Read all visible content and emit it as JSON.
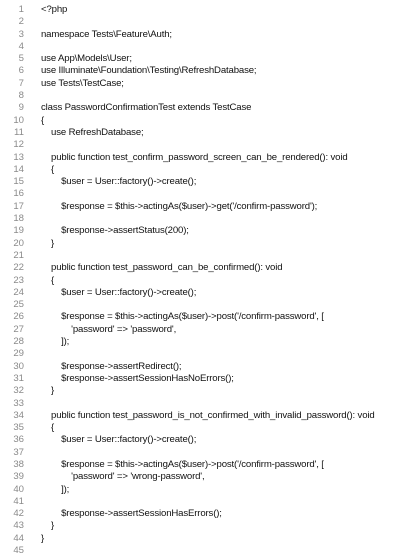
{
  "editor": {
    "lines": [
      {
        "n": "1",
        "t": "<?php"
      },
      {
        "n": "2",
        "t": ""
      },
      {
        "n": "3",
        "t": "namespace Tests\\Feature\\Auth;"
      },
      {
        "n": "4",
        "t": ""
      },
      {
        "n": "5",
        "t": "use App\\Models\\User;"
      },
      {
        "n": "6",
        "t": "use Illuminate\\Foundation\\Testing\\RefreshDatabase;"
      },
      {
        "n": "7",
        "t": "use Tests\\TestCase;"
      },
      {
        "n": "8",
        "t": ""
      },
      {
        "n": "9",
        "t": "class PasswordConfirmationTest extends TestCase"
      },
      {
        "n": "10",
        "t": "{"
      },
      {
        "n": "11",
        "t": "    use RefreshDatabase;"
      },
      {
        "n": "12",
        "t": ""
      },
      {
        "n": "13",
        "t": "    public function test_confirm_password_screen_can_be_rendered(): void"
      },
      {
        "n": "14",
        "t": "    {"
      },
      {
        "n": "15",
        "t": "        $user = User::factory()->create();"
      },
      {
        "n": "16",
        "t": ""
      },
      {
        "n": "17",
        "t": "        $response = $this->actingAs($user)->get('/confirm-password');"
      },
      {
        "n": "18",
        "t": ""
      },
      {
        "n": "19",
        "t": "        $response->assertStatus(200);"
      },
      {
        "n": "20",
        "t": "    }"
      },
      {
        "n": "21",
        "t": ""
      },
      {
        "n": "22",
        "t": "    public function test_password_can_be_confirmed(): void"
      },
      {
        "n": "23",
        "t": "    {"
      },
      {
        "n": "24",
        "t": "        $user = User::factory()->create();"
      },
      {
        "n": "25",
        "t": ""
      },
      {
        "n": "26",
        "t": "        $response = $this->actingAs($user)->post('/confirm-password', ["
      },
      {
        "n": "27",
        "t": "            'password' => 'password',"
      },
      {
        "n": "28",
        "t": "        ]);"
      },
      {
        "n": "29",
        "t": ""
      },
      {
        "n": "30",
        "t": "        $response->assertRedirect();"
      },
      {
        "n": "31",
        "t": "        $response->assertSessionHasNoErrors();"
      },
      {
        "n": "32",
        "t": "    }"
      },
      {
        "n": "33",
        "t": ""
      },
      {
        "n": "34",
        "t": "    public function test_password_is_not_confirmed_with_invalid_password(): void"
      },
      {
        "n": "35",
        "t": "    {"
      },
      {
        "n": "36",
        "t": "        $user = User::factory()->create();"
      },
      {
        "n": "37",
        "t": ""
      },
      {
        "n": "38",
        "t": "        $response = $this->actingAs($user)->post('/confirm-password', ["
      },
      {
        "n": "39",
        "t": "            'password' => 'wrong-password',"
      },
      {
        "n": "40",
        "t": "        ]);"
      },
      {
        "n": "41",
        "t": ""
      },
      {
        "n": "42",
        "t": "        $response->assertSessionHasErrors();"
      },
      {
        "n": "43",
        "t": "    }"
      },
      {
        "n": "44",
        "t": "}"
      },
      {
        "n": "45",
        "t": ""
      }
    ]
  }
}
